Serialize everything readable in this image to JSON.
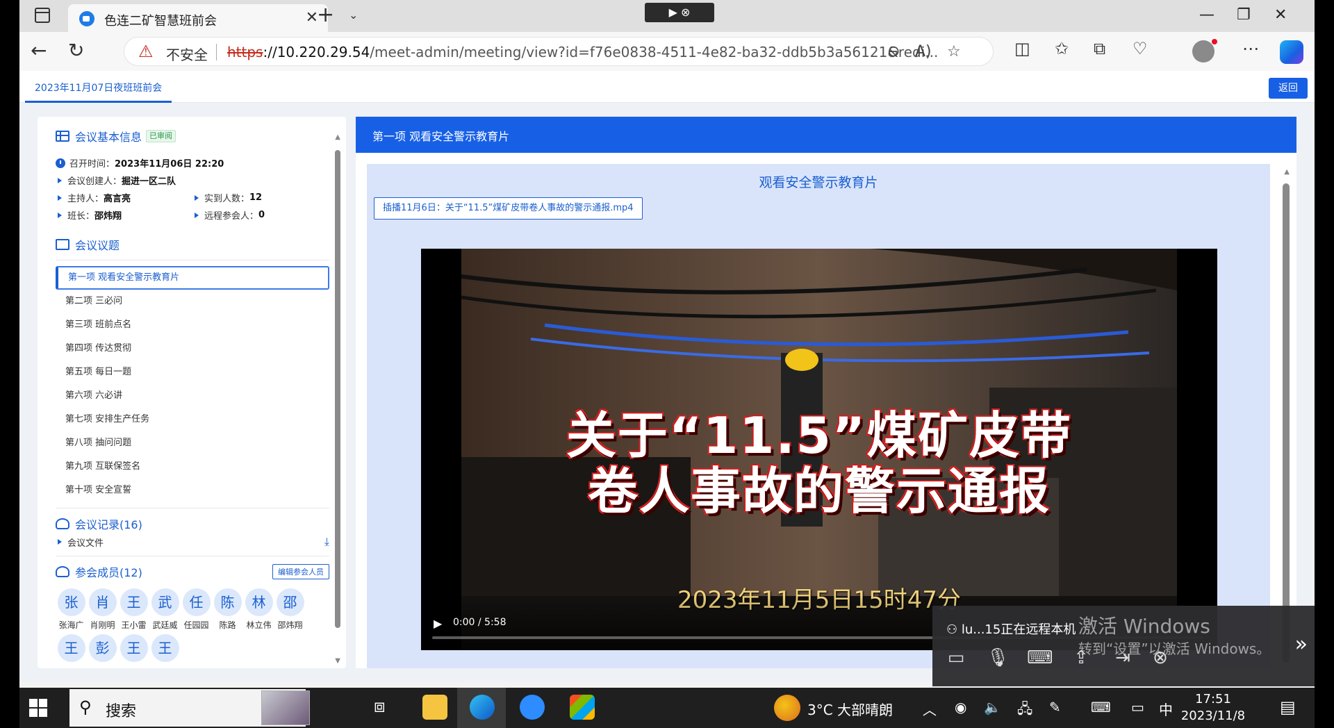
{
  "browser": {
    "tab_title": "色连二矿智慧班前会",
    "share_pill": "▶ ⊗",
    "security_label": "不安全",
    "url_scheme": "https",
    "url_host": "://10.220.29.54",
    "url_path": "/meet-admin/meeting/view?id=f76e0838-4511-4e82-ba32-ddb5b3a56121&redi..."
  },
  "app": {
    "meeting_tab": "2023年11月07日夜班班前会",
    "back_button": "返回"
  },
  "left_panel": {
    "basic_info": {
      "title": "会议基本信息",
      "status_badge": "已审阅",
      "start_label": "召开时间：",
      "start_value": "2023年11月06日 22:20",
      "creator_label": "会议创建人：",
      "creator_value": "掘进一区二队",
      "host_label": "主持人：",
      "host_value": "高言亮",
      "actual_label": "实到人数：",
      "actual_value": "12",
      "leader_label": "班长：",
      "leader_value": "邵炜翔",
      "remote_label": "远程参会人：",
      "remote_value": "0"
    },
    "agenda": {
      "title": "会议议题",
      "items": [
        "第一项 观看安全警示教育片",
        "第二项 三必问",
        "第三项 班前点名",
        "第四项 传达贯彻",
        "第五项 每日一题",
        "第六项 六必讲",
        "第七项 安排生产任务",
        "第八项 抽问问题",
        "第九项 互联保签名",
        "第十项 安全宣誓"
      ]
    },
    "records": {
      "title": "会议记录(16)",
      "file_label": "会议文件"
    },
    "members": {
      "title": "参会成员(12)",
      "edit_button": "编辑参会人员",
      "list": [
        {
          "avatar": "张",
          "name": "张海广"
        },
        {
          "avatar": "肖",
          "name": "肖刚明"
        },
        {
          "avatar": "王",
          "name": "王小雷"
        },
        {
          "avatar": "武",
          "name": "武廷威"
        },
        {
          "avatar": "任",
          "name": "任园园"
        },
        {
          "avatar": "陈",
          "name": "陈路"
        },
        {
          "avatar": "林",
          "name": "林立伟"
        },
        {
          "avatar": "邵",
          "name": "邵炜翔"
        },
        {
          "avatar": "王",
          "name": ""
        },
        {
          "avatar": "彭",
          "name": ""
        },
        {
          "avatar": "王",
          "name": ""
        },
        {
          "avatar": "王",
          "name": ""
        }
      ]
    }
  },
  "right_panel": {
    "header": "第一项 观看安全警示教育片",
    "title": "观看安全警示教育片",
    "file_chip": "插播11月6日：关于“11.5”煤矿皮带卷人事故的警示通报.mp4",
    "video": {
      "headline1": "关于“11.5”煤矿皮带",
      "headline2": "卷人事故的警示通报",
      "date_caption": "2023年11月5日15时47分",
      "time": "0:00 / 5:58",
      "progress": 0.0
    }
  },
  "remote_overlay": {
    "user_text": "lu...15正在远程本机",
    "watermark_line1": "激活 Windows",
    "watermark_line2": "转到“设置”以激活 Windows。"
  },
  "taskbar": {
    "search_label": "搜索",
    "weather": "3°C  大部晴朗",
    "ime": "中",
    "time": "17:51",
    "date": "2023/11/8"
  }
}
